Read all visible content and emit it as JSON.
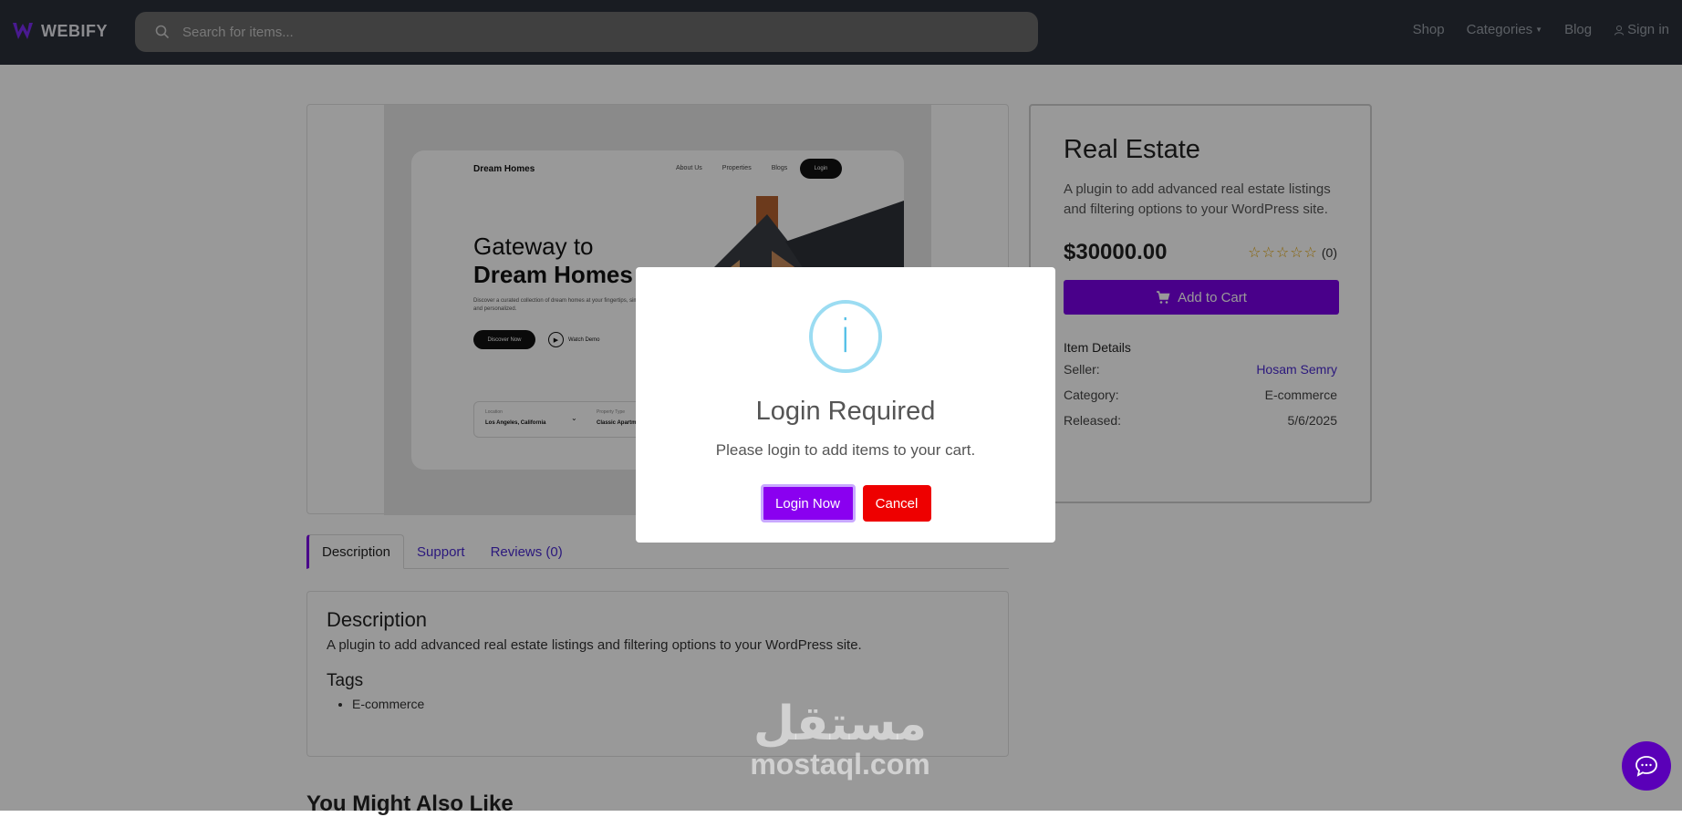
{
  "header": {
    "brand": "WEBIFY",
    "search_placeholder": "Search for items...",
    "links": {
      "shop": "Shop",
      "categories": "Categories",
      "blog": "Blog",
      "signin": "Sign in"
    }
  },
  "preview": {
    "brand": "Dream Homes",
    "links": [
      "About Us",
      "Properties",
      "Blogs"
    ],
    "login": "Login",
    "headline_line1": "Gateway to",
    "headline_line2": "Dream Homes",
    "subtext": "Discover a curated collection of dream homes at your fingertips, simplified and personalized.",
    "discover": "Discover Now",
    "watch": "Watch Demo",
    "filter_location_label": "Location",
    "filter_location_value": "Los Angeles, California",
    "filter_type_label": "Property Type",
    "filter_type_value": "Classic Apartme..."
  },
  "tabs": {
    "description": "Description",
    "support": "Support",
    "reviews": "Reviews (0)"
  },
  "description": {
    "heading": "Description",
    "text": "A plugin to add advanced real estate listings and filtering options to your WordPress site.",
    "tags_heading": "Tags",
    "tags": [
      "E-commerce"
    ]
  },
  "also_like": "You Might Also Like",
  "product": {
    "title": "Real Estate",
    "desc": "A plugin to add advanced real estate listings and filtering options to your WordPress site.",
    "price": "$30000.00",
    "rating": 0,
    "review_count": "(0)",
    "add_to_cart": "Add to Cart",
    "details_heading": "Item Details",
    "seller_label": "Seller:",
    "seller": "Hosam Semry",
    "category_label": "Category:",
    "category": "E-commerce",
    "released_label": "Released:",
    "released": "5/6/2025"
  },
  "modal": {
    "icon": "info-icon",
    "title": "Login Required",
    "text": "Please login to add items to your cart.",
    "login_button": "Login Now",
    "cancel_button": "Cancel"
  },
  "watermark": {
    "arabic": "مستقل",
    "latin": "mostaql.com"
  },
  "colors": {
    "accent": "#7a00e6",
    "cancel": "#ee0000",
    "nav_bg": "#2a2f3a",
    "info": "#4fbde6"
  }
}
